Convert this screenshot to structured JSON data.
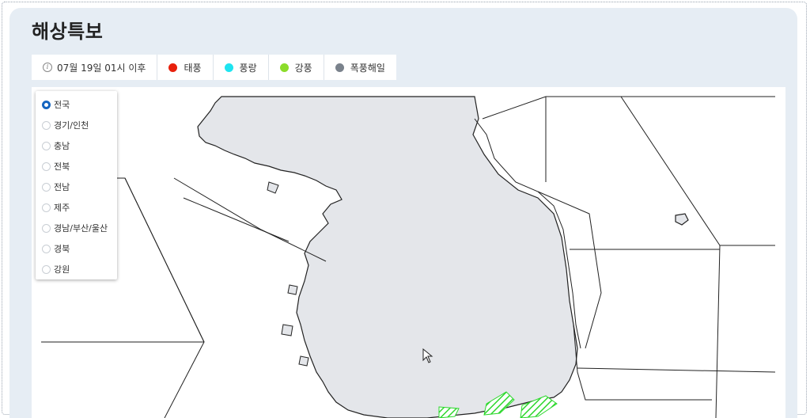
{
  "page": {
    "title": "해상특보"
  },
  "legend": {
    "issued_time": "07월 19일 01시 이후",
    "items": [
      {
        "label": "태풍",
        "color": "#e8200c"
      },
      {
        "label": "풍랑",
        "color": "#1ee4f0"
      },
      {
        "label": "강풍",
        "color": "#8bdc2a"
      },
      {
        "label": "폭풍해일",
        "color": "#7a828c"
      }
    ]
  },
  "regions": {
    "selected": "전국",
    "items": [
      "전국",
      "경기/인천",
      "충남",
      "전북",
      "전남",
      "제주",
      "경남/부산/울산",
      "경북",
      "강원"
    ]
  },
  "map": {
    "land_color": "#e4e6ea",
    "sea_color": "#ffffff",
    "warning_hatch_color": "#2ed82e",
    "active_warning": "강풍"
  }
}
